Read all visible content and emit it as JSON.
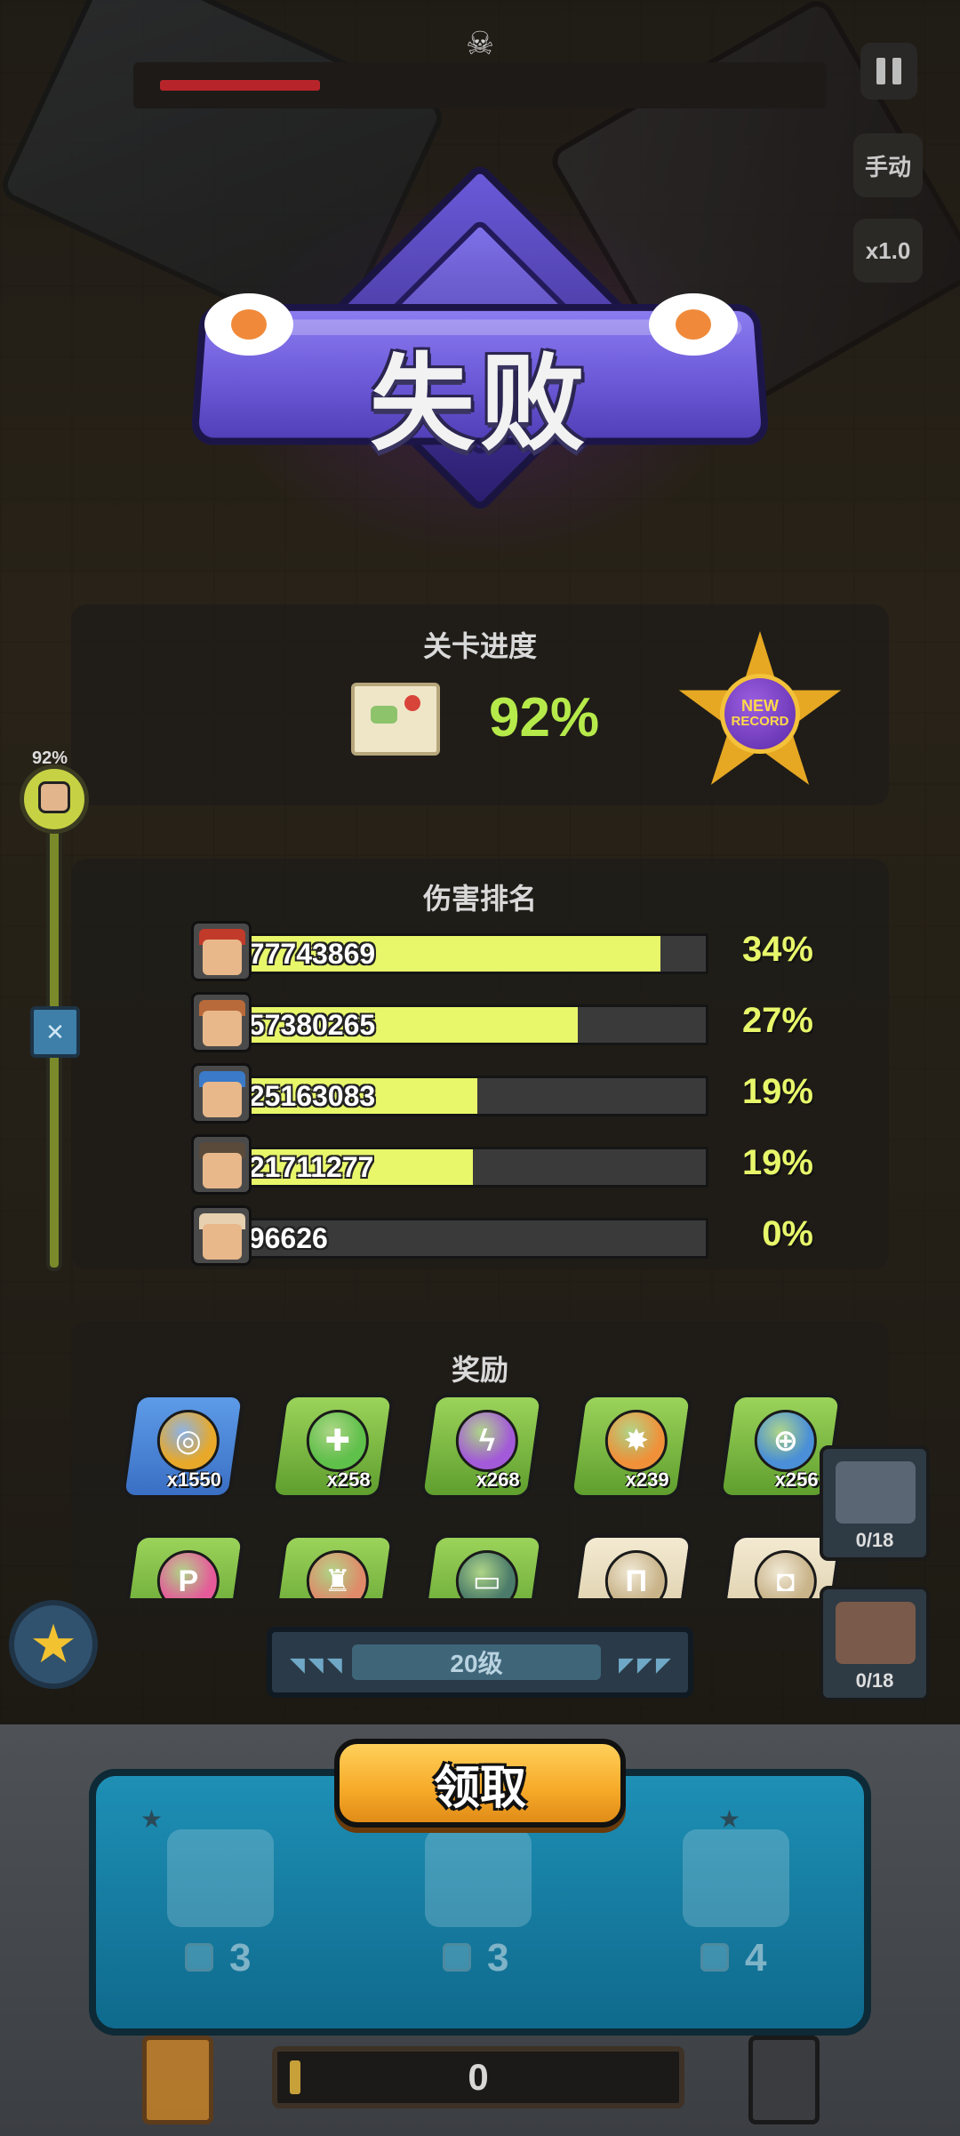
{
  "hud": {
    "boss_health": 0.25,
    "skull_icon": "skull-icon",
    "pause_icon": "pause-icon",
    "mode_label": "手动",
    "speed_label": "x1.0"
  },
  "result": {
    "title": "失败"
  },
  "progress": {
    "title": "关卡进度",
    "percent": "92%",
    "map_icon": "map-icon",
    "record_line1": "NEW",
    "record_line2": "RECORD"
  },
  "damage": {
    "title": "伤害排名",
    "rows": [
      {
        "value": "577743869",
        "percent": "34%",
        "fill": 0.9,
        "hair": "#c23a2a"
      },
      {
        "value": "457380265",
        "percent": "27%",
        "fill": 0.72,
        "hair": "#b96a3a"
      },
      {
        "value": "325163083",
        "percent": "19%",
        "fill": 0.5,
        "hair": "#3a7ac9"
      },
      {
        "value": "321711277",
        "percent": "19%",
        "fill": 0.49,
        "hair": "#5a4a3a"
      },
      {
        "value": "796626",
        "percent": "0%",
        "fill": 0.0,
        "hair": "#e6d0b0"
      }
    ]
  },
  "rewards": {
    "title": "奖励",
    "items": [
      {
        "qty": "x1550",
        "icon": "gold-coin-icon",
        "card": "blue",
        "orb": "#e8a92a",
        "glyph": "◎"
      },
      {
        "qty": "x258",
        "icon": "heal-plus-icon",
        "card": "green",
        "orb": "#5fc04a",
        "glyph": "✚"
      },
      {
        "qty": "x268",
        "icon": "lightning-icon",
        "card": "green",
        "orb": "#a35ad8",
        "glyph": "ϟ"
      },
      {
        "qty": "x239",
        "icon": "explosion-icon",
        "card": "green",
        "orb": "#f0913a",
        "glyph": "✸"
      },
      {
        "qty": "x256",
        "icon": "target-icon",
        "card": "green",
        "orb": "#4a8fd8",
        "glyph": "⊕"
      },
      {
        "qty": "",
        "icon": "pistol-icon",
        "card": "green",
        "orb": "#e65a9a",
        "glyph": "P"
      },
      {
        "qty": "",
        "icon": "tower-icon",
        "card": "green",
        "orb": "#e08a6a",
        "glyph": "♜"
      },
      {
        "qty": "",
        "icon": "chest-icon",
        "card": "green",
        "orb": "#4a7a6a",
        "glyph": "▭"
      },
      {
        "qty": "",
        "icon": "pants-icon",
        "card": "beige",
        "orb": "#c9b48a",
        "glyph": "Π"
      },
      {
        "qty": "",
        "icon": "backpack-icon",
        "card": "beige",
        "orb": "#c9b48a",
        "glyph": "◘"
      }
    ]
  },
  "level_track": {
    "percent": "92%",
    "marker_icon": "bone-icon"
  },
  "side_cards": [
    {
      "count": "0/18",
      "icon": "tank-icon"
    },
    {
      "count": "0/18",
      "icon": "chicken-hero-icon"
    }
  ],
  "console": {
    "level_label": "20级",
    "claim_label": "领取",
    "slots": [
      {
        "count": "3",
        "icon": "robot-ghost-icon"
      },
      {
        "count": "3",
        "icon": "robot-ghost-icon"
      },
      {
        "count": "4",
        "icon": "robot-ghost-icon"
      }
    ],
    "currency": "0",
    "star_icon": "star-icon"
  }
}
